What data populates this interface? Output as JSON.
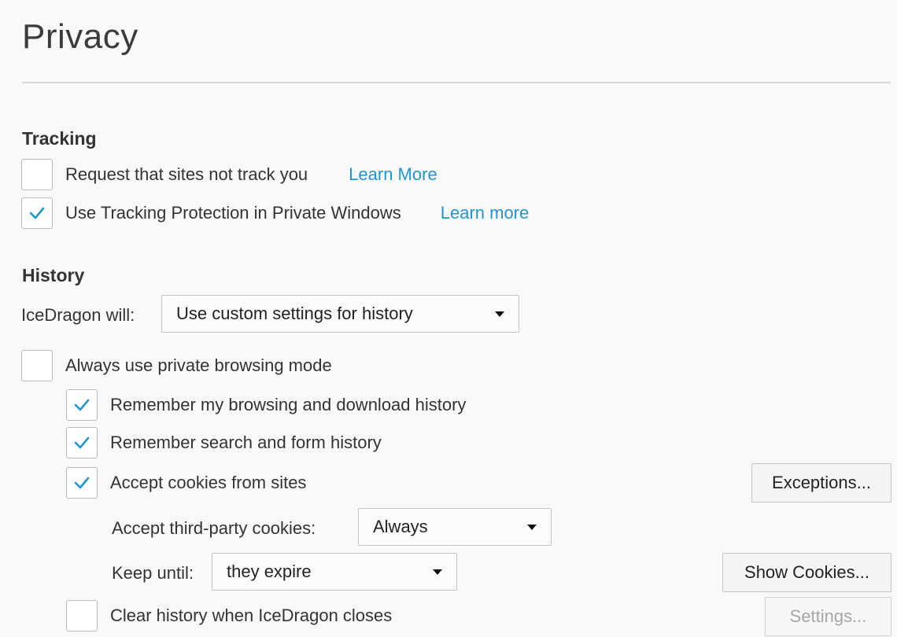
{
  "page": {
    "title": "Privacy"
  },
  "tracking": {
    "heading": "Tracking",
    "do_not_track": {
      "label": "Request that sites not track you",
      "checked": false,
      "link": "Learn More"
    },
    "tracking_protection": {
      "label": "Use Tracking Protection in Private Windows",
      "checked": true,
      "link": "Learn more"
    }
  },
  "history": {
    "heading": "History",
    "will_label": "IceDragon will:",
    "will_value": "Use custom settings for history",
    "always_private": {
      "label": "Always use private browsing mode",
      "checked": false
    },
    "remember_browsing": {
      "label": "Remember my browsing and download history",
      "checked": true
    },
    "remember_search": {
      "label": "Remember search and form history",
      "checked": true
    },
    "accept_cookies": {
      "label": "Accept cookies from sites",
      "checked": true
    },
    "exceptions_button": "Exceptions...",
    "third_party_label": "Accept third-party cookies:",
    "third_party_value": "Always",
    "keep_until_label": "Keep until:",
    "keep_until_value": "they expire",
    "show_cookies_button": "Show Cookies...",
    "clear_on_close": {
      "label": "Clear history when IceDragon closes",
      "checked": false
    },
    "settings_button": "Settings..."
  },
  "colors": {
    "accent": "#1f96d6",
    "checkmark": "#1f96d6",
    "background": "#f9f9fa"
  }
}
